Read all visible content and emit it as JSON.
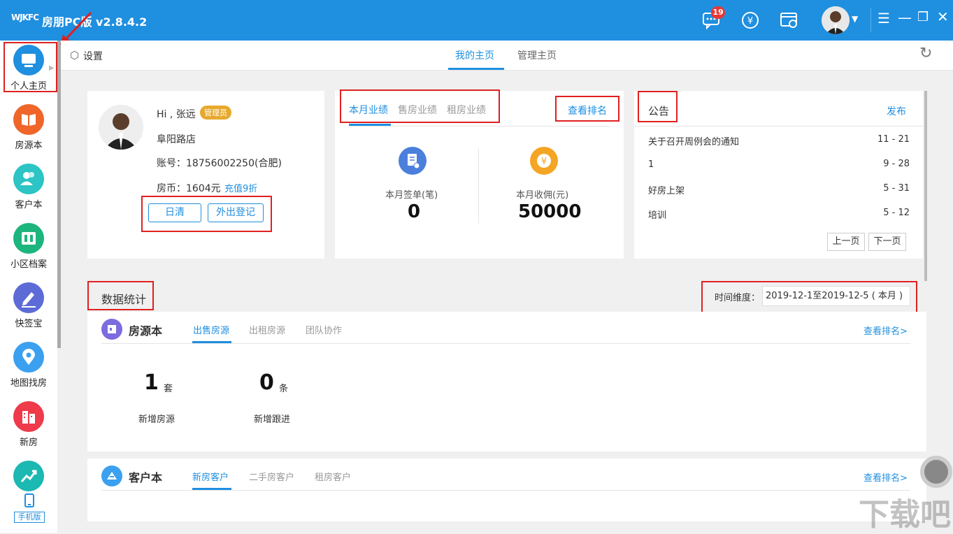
{
  "titlebar": {
    "logo": "WJKFC",
    "title": "房朋PC版 v2.8.4.2",
    "badge_count": "19"
  },
  "sidebar": {
    "items": [
      {
        "label": "个人主页",
        "icon": "monitor-icon",
        "color": "#1f8fe0"
      },
      {
        "label": "房源本",
        "icon": "book-icon",
        "color": "#f06529"
      },
      {
        "label": "客户本",
        "icon": "people-icon",
        "color": "#2cc4c4"
      },
      {
        "label": "小区档案",
        "icon": "map-icon",
        "color": "#1db57e"
      },
      {
        "label": "快签宝",
        "icon": "pen-icon",
        "color": "#5c6bd6"
      },
      {
        "label": "地图找房",
        "icon": "location-icon",
        "color": "#3ba0f0"
      },
      {
        "label": "新房",
        "icon": "building-icon",
        "color": "#ee3a4a"
      },
      {
        "label": "",
        "icon": "trend-icon",
        "color": "#1cb8b2"
      }
    ],
    "mobile_label": "手机版"
  },
  "topbar": {
    "settings": "设置",
    "tabs": [
      "我的主页",
      "管理主页"
    ]
  },
  "profile": {
    "greeting": "Hi , 张远",
    "role": "管理员",
    "store": "阜阳路店",
    "account": "账号：18756002250(合肥)",
    "coins": "房币：1604元",
    "recharge": "充值9折",
    "btn_daily": "日清",
    "btn_out": "外出登记"
  },
  "performance": {
    "tabs": [
      "本月业绩",
      "售房业绩",
      "租房业绩"
    ],
    "ranking": "查看排名",
    "sign_label": "本月签单(笔)",
    "sign_value": "0",
    "commission_label": "本月收佣(元)",
    "commission_value": "50000"
  },
  "notice": {
    "title": "公告",
    "publish": "发布",
    "items": [
      {
        "title": "关于召开周例会的通知",
        "date": "11 - 21"
      },
      {
        "title": "1",
        "date": "9 - 28"
      },
      {
        "title": "好房上架",
        "date": "5 - 31"
      },
      {
        "title": "培训",
        "date": "5 - 12"
      }
    ],
    "prev": "上一页",
    "next": "下一页"
  },
  "stats": {
    "title": "数据统计",
    "time_label": "时间维度：",
    "time_value": "2019-12-1至2019-12-5 ( 本月 )"
  },
  "house": {
    "title": "房源本",
    "tabs": [
      "出售房源",
      "出租房源",
      "团队协作"
    ],
    "ranking": "查看排名>",
    "new_count": "1",
    "new_unit": "套",
    "new_label": "新增房源",
    "follow_count": "0",
    "follow_unit": "条",
    "follow_label": "新增跟进"
  },
  "customer": {
    "title": "客户本",
    "tabs": [
      "新房客户",
      "二手房客户",
      "租房客户"
    ],
    "ranking": "查看排名>"
  },
  "watermark": "下载吧"
}
